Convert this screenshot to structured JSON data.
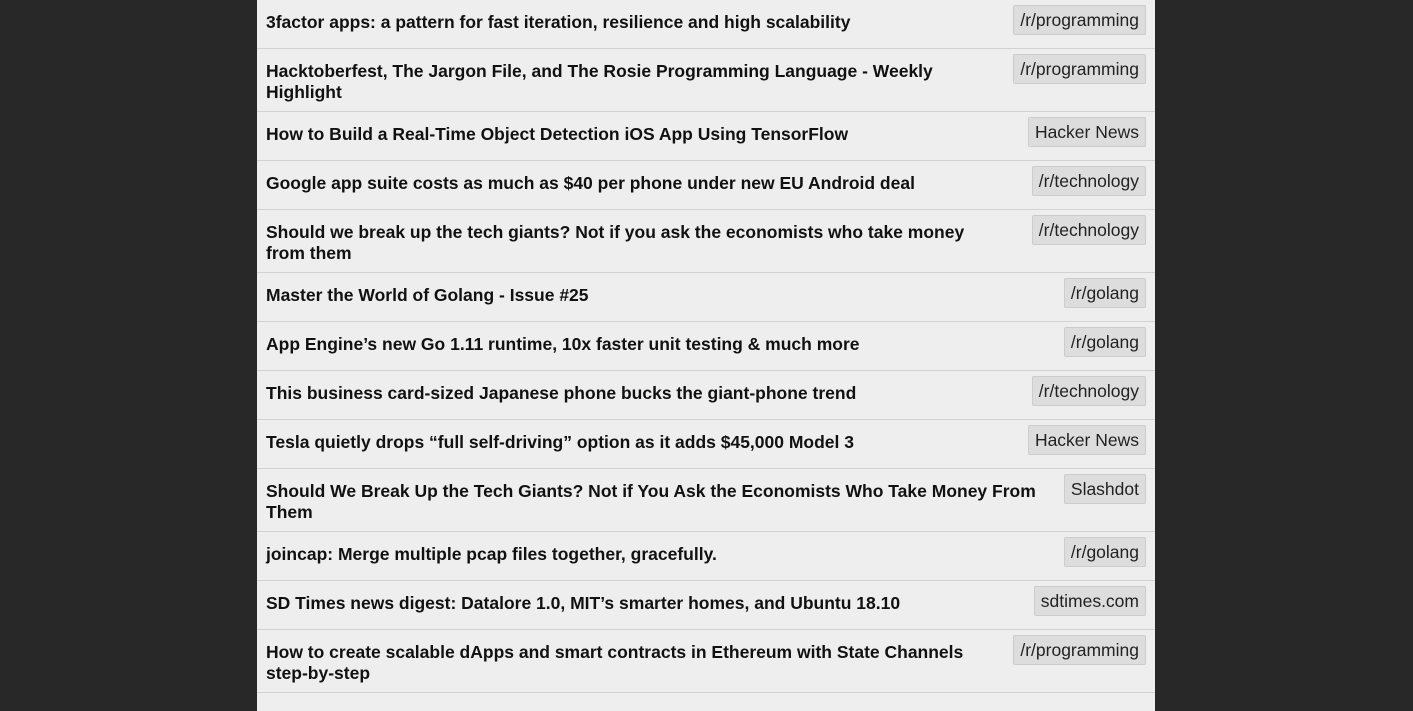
{
  "items": [
    {
      "title": "3factor apps: a pattern for fast iteration, resilience and high scalability",
      "source": "/r/programming"
    },
    {
      "title": "Hacktoberfest, The Jargon File, and The Rosie Programming Language - Weekly Highlight",
      "source": "/r/programming"
    },
    {
      "title": "How to Build a Real-Time Object Detection iOS App Using TensorFlow",
      "source": "Hacker News"
    },
    {
      "title": "Google app suite costs as much as $40 per phone under new EU Android deal",
      "source": "/r/technology"
    },
    {
      "title": "Should we break up the tech giants? Not if you ask the economists who take money from them",
      "source": "/r/technology"
    },
    {
      "title": "Master the World of Golang - Issue #25",
      "source": "/r/golang"
    },
    {
      "title": "App Engine’s new Go 1.11 runtime, 10x faster unit testing & much more",
      "source": "/r/golang"
    },
    {
      "title": "This business card-sized Japanese phone bucks the giant-phone trend",
      "source": "/r/technology"
    },
    {
      "title": "Tesla quietly drops “full self-driving” option as it adds $45,000 Model 3",
      "source": "Hacker News"
    },
    {
      "title": "Should We Break Up the Tech Giants? Not if You Ask the Economists Who Take Money From Them",
      "source": "Slashdot"
    },
    {
      "title": "joincap: Merge multiple pcap files together, gracefully.",
      "source": "/r/golang"
    },
    {
      "title": "SD Times news digest: Datalore 1.0, MIT’s smarter homes, and Ubuntu 18.10",
      "source": "sdtimes.com"
    },
    {
      "title": "How to create scalable dApps and smart contracts in Ethereum with State Channels step-by-step",
      "source": "/r/programming"
    }
  ]
}
